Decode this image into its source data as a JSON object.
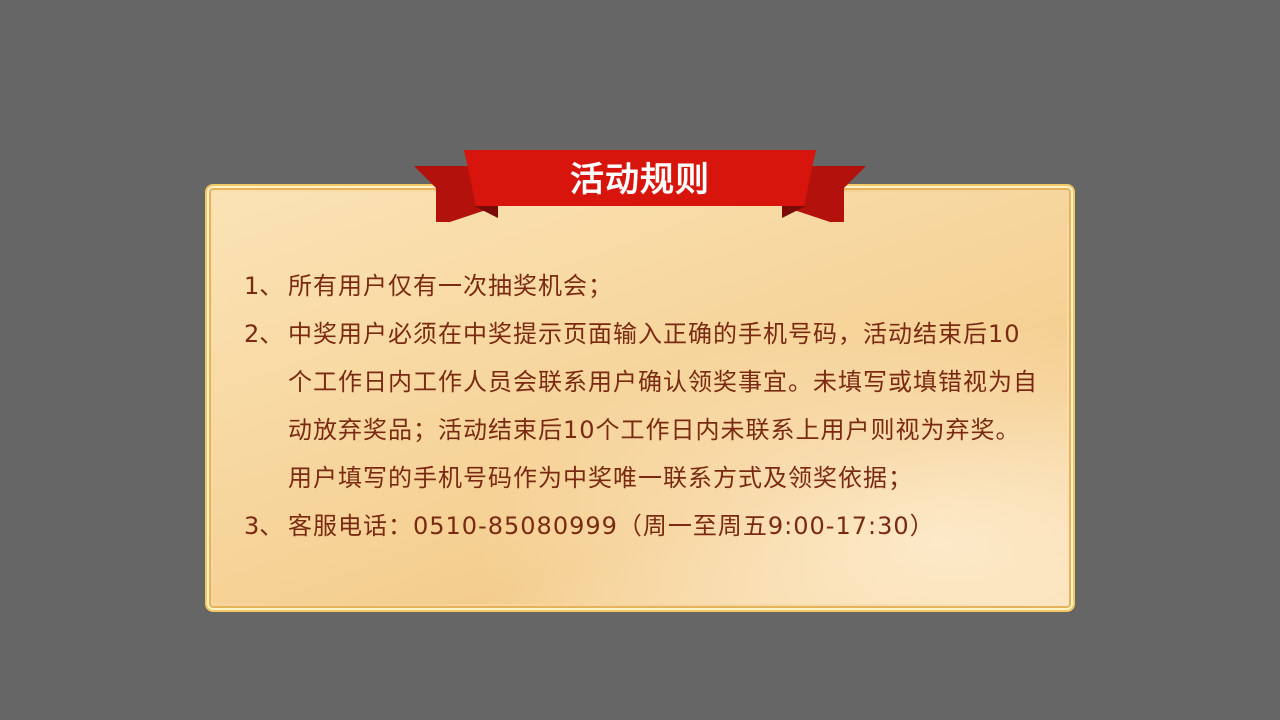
{
  "title": "活动规则",
  "rules": [
    {
      "num": "1、",
      "text": "所有用户仅有一次抽奖机会；"
    },
    {
      "num": "2、",
      "text": "中奖用户必须在中奖提示页面输入正确的手机号码，活动结束后10个工作日内工作人员会联系用户确认领奖事宜。未填写或填错视为自动放弃奖品；活动结束后10个工作日内未联系上用户则视为弃奖。用户填写的手机号码作为中奖唯一联系方式及领奖依据；"
    },
    {
      "num": "3、",
      "text": "客服电话：0510-85080999（周一至周五9:00-17:30）"
    }
  ],
  "colors": {
    "background": "#666666",
    "ribbon": "#d0140c",
    "ribbon_dark": "#a80f0a",
    "text": "#7a2a12",
    "border": "#f0c864"
  }
}
